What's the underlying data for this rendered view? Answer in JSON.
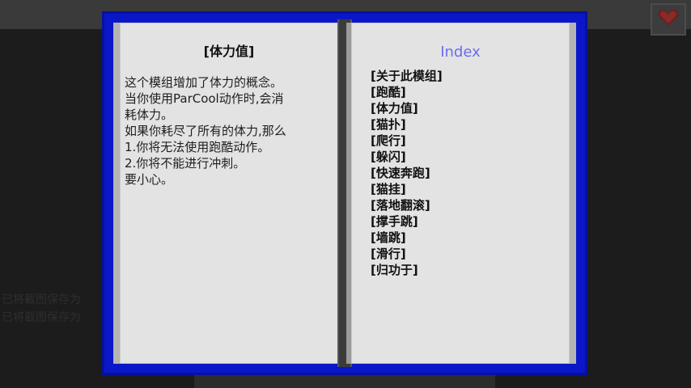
{
  "left_page": {
    "title": "[体力值]",
    "lines": [
      "这个模组增加了体力的概念。",
      "当你使用ParCool动作时,会消",
      "耗体力。",
      "如果你耗尽了所有的体力,那么",
      "1.你将无法使用跑酷动作。",
      "2.你将不能进行冲刺。",
      "要小心。"
    ]
  },
  "right_page": {
    "title": "Index",
    "items": [
      "[关于此模组]",
      "[跑酷]",
      "[体力值]",
      "[猫扑]",
      "[爬行]",
      "[躲闪]",
      "[快速奔跑]",
      "[猫挂]",
      "[落地翻滚]",
      "[撑手跳]",
      "[墙跳]",
      "[滑行]",
      "[归功于]"
    ]
  },
  "background": {
    "chat_lines": [
      "已将截图保存为",
      "已将截图保存为"
    ]
  },
  "hud": {
    "heart_icon": "heart-icon"
  },
  "colors": {
    "book_cover": "#0a17c8",
    "page": "#e3e3e3",
    "index_title": "#6b6bf0"
  }
}
